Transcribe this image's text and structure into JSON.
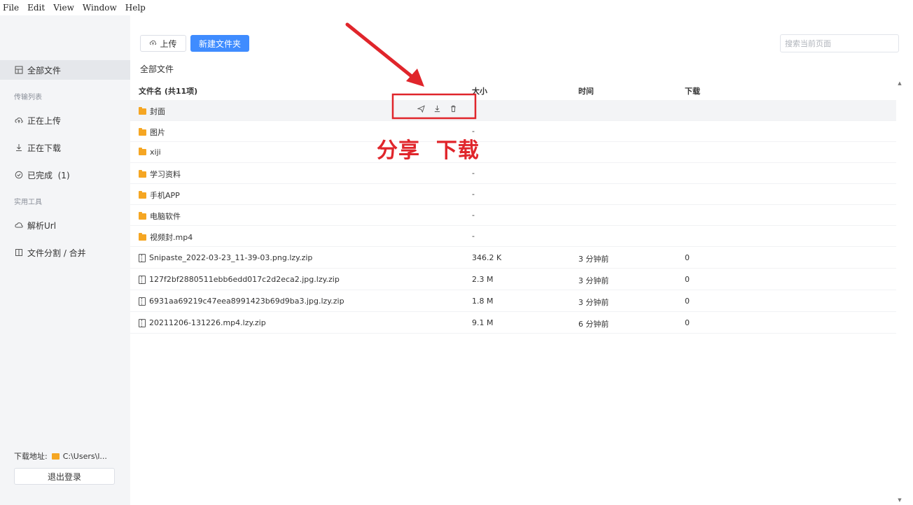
{
  "menu": [
    "File",
    "Edit",
    "View",
    "Window",
    "Help"
  ],
  "sidebar": {
    "items": [
      {
        "label": "全部文件",
        "icon": "files-icon"
      },
      {
        "label": "正在上传",
        "icon": "cloud-upload-icon"
      },
      {
        "label": "正在下载",
        "icon": "download-icon"
      },
      {
        "label": "已完成  (1)",
        "icon": "check-circle-icon"
      },
      {
        "label": "解析Url",
        "icon": "cloud-link-icon"
      },
      {
        "label": "文件分割 / 合并",
        "icon": "split-merge-icon"
      }
    ],
    "headings": [
      "传输列表",
      "实用工具"
    ],
    "download_path_label": "下载地址:",
    "download_path_value": "C:\\Users\\l...",
    "logout_label": "退出登录"
  },
  "toolbar": {
    "upload_label": "上传",
    "new_folder_label": "新建文件夹",
    "search_placeholder": "搜索当前页面"
  },
  "breadcrumb": "全部文件",
  "table": {
    "headers": [
      "文件名 (共11项)",
      "大小",
      "时间",
      "下载"
    ],
    "rows": [
      {
        "type": "folder",
        "name": "封面",
        "size": "",
        "time": "",
        "downloads": ""
      },
      {
        "type": "folder",
        "name": "图片",
        "size": "-",
        "time": "",
        "downloads": ""
      },
      {
        "type": "folder",
        "name": "xiji",
        "size": "-",
        "time": "",
        "downloads": ""
      },
      {
        "type": "folder",
        "name": "学习资料",
        "size": "-",
        "time": "",
        "downloads": ""
      },
      {
        "type": "folder",
        "name": "手机APP",
        "size": "-",
        "time": "",
        "downloads": ""
      },
      {
        "type": "folder",
        "name": "电脑软件",
        "size": "-",
        "time": "",
        "downloads": ""
      },
      {
        "type": "folder",
        "name": "视频封.mp4",
        "size": "-",
        "time": "",
        "downloads": ""
      },
      {
        "type": "file",
        "name": "Snipaste_2022-03-23_11-39-03.png.lzy.zip",
        "size": "346.2 K",
        "time": "3 分钟前",
        "downloads": "0"
      },
      {
        "type": "file",
        "name": "127f2bf2880511ebb6edd017c2d2eca2.jpg.lzy.zip",
        "size": "2.3 M",
        "time": "3 分钟前",
        "downloads": "0"
      },
      {
        "type": "file",
        "name": "6931aa69219c47eea8991423b69d9ba3.jpg.lzy.zip",
        "size": "1.8 M",
        "time": "3 分钟前",
        "downloads": "0"
      },
      {
        "type": "file",
        "name": "20211206-131226.mp4.lzy.zip",
        "size": "9.1 M",
        "time": "6 分钟前",
        "downloads": "0"
      }
    ],
    "row_action_icons": [
      "share-icon",
      "download-icon",
      "delete-icon"
    ]
  },
  "annotation": {
    "text": "分享  下载",
    "color": "#e0252b"
  },
  "colors": {
    "accent": "#3f8cff",
    "folder": "#f5a623",
    "sidebar_bg": "#f4f5f7"
  }
}
